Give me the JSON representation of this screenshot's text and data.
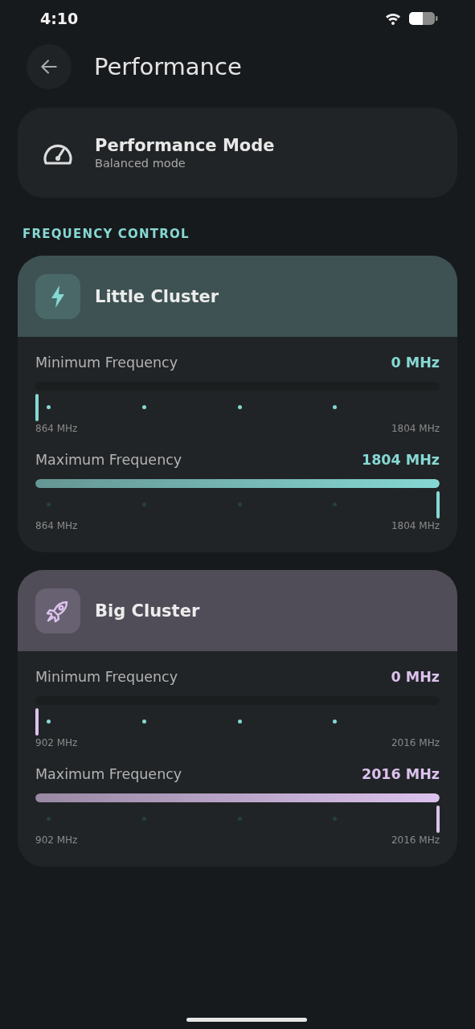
{
  "status_bar": {
    "time": "4:10"
  },
  "header": {
    "title": "Performance"
  },
  "mode_card": {
    "title": "Performance Mode",
    "subtitle": "Balanced mode"
  },
  "section_label": "FREQUENCY CONTROL",
  "clusters": [
    {
      "name": "Little Cluster",
      "color": "#86d8d4",
      "sliders": [
        {
          "label": "Minimum Frequency",
          "reading": "0 MHz",
          "level": 0,
          "min_label": "864 MHz",
          "max_label": "1804 MHz"
        },
        {
          "label": "Maximum Frequency",
          "reading": "1804 MHz",
          "level": 1,
          "min_label": "864 MHz",
          "max_label": "1804 MHz"
        }
      ]
    },
    {
      "name": "Big Cluster",
      "color": "#dcc2ee",
      "sliders": [
        {
          "label": "Minimum Frequency",
          "reading": "0 MHz",
          "level": 0,
          "min_label": "902 MHz",
          "max_label": "2016 MHz"
        },
        {
          "label": "Maximum Frequency",
          "reading": "2016 MHz",
          "level": 1,
          "min_label": "902 MHz",
          "max_label": "2016 MHz"
        }
      ]
    }
  ]
}
